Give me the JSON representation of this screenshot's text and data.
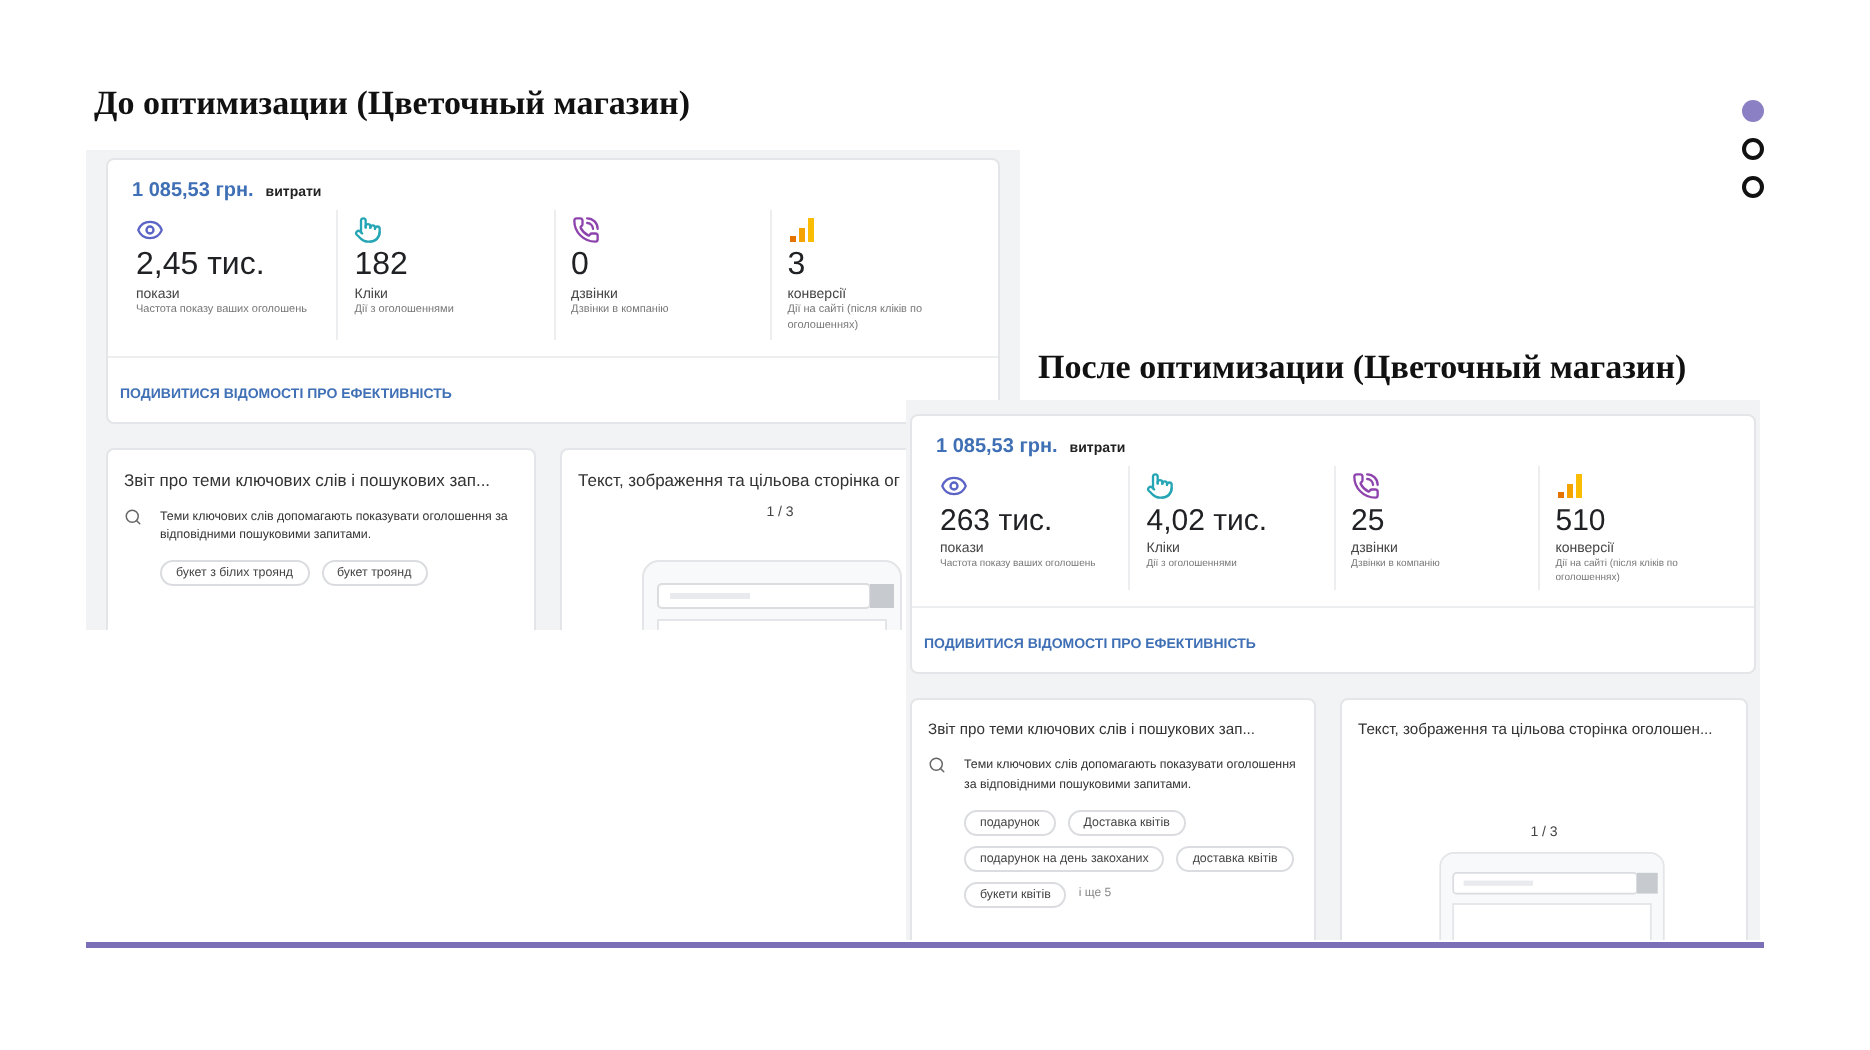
{
  "pagination": [
    {
      "selected": true
    },
    {
      "selected": false
    },
    {
      "selected": false
    }
  ],
  "panels": [
    {
      "kind": "before",
      "title": "До оптимизации (Цветочный магазин)",
      "summary": {
        "amount": "1 085,53 грн.",
        "amount_label": "витрати",
        "metrics": [
          {
            "kind": "impressions",
            "value": "2,45 тис.",
            "label": "покази",
            "description": "Частота показу ваших оголошень"
          },
          {
            "kind": "clicks",
            "value": "182",
            "label": "Кліки",
            "description": "Дії з оголошеннями"
          },
          {
            "kind": "calls",
            "value": "0",
            "label": "дзвінки",
            "description": "Дзвінки в компанію"
          },
          {
            "kind": "conversions",
            "value": "3",
            "label": "конверсії",
            "description": "Дії на сайті (після кліків по оголошеннях)"
          }
        ],
        "link": "ПОДИВИТИСЯ ВІДОМОСТІ ПРО ЕФЕКТИВНІСТЬ"
      },
      "keyword_card": {
        "title": "Звіт про теми ключових слів і пошукових зап...",
        "description": "Теми ключових слів допомагають показувати оголошення за відповідними пошуковими запитами.",
        "chips": [
          "букет з білих троянд",
          "букет троянд"
        ]
      },
      "ad_card": {
        "title": "Текст, зображення та цільова сторінка ог",
        "pager": "1 / 3"
      }
    },
    {
      "kind": "after",
      "title": "После оптимизации (Цветочный магазин)",
      "summary": {
        "amount": "1 085,53 грн.",
        "amount_label": "витрати",
        "metrics": [
          {
            "kind": "impressions",
            "value": "263 тис.",
            "label": "покази",
            "description": "Частота показу ваших оголошень"
          },
          {
            "kind": "clicks",
            "value": "4,02 тис.",
            "label": "Кліки",
            "description": "Дії з оголошеннями"
          },
          {
            "kind": "calls",
            "value": "25",
            "label": "дзвінки",
            "description": "Дзвінки в компанію"
          },
          {
            "kind": "conversions",
            "value": "510",
            "label": "конверсії",
            "description": "Дії на сайті (після кліків по оголошеннях)"
          }
        ],
        "link": "ПОДИВИТИСЯ ВІДОМОСТІ ПРО ЕФЕКТИВНІСТЬ"
      },
      "keyword_card": {
        "title": "Звіт про теми ключових слів і пошукових зап...",
        "description": "Теми ключових слів допомагають показувати оголошення за відповідними пошуковими запитами.",
        "chips": [
          "подарунок",
          "Доставка квітів",
          "подарунок на день закоханих",
          "доставка квітів",
          "букети квітів"
        ],
        "more": "і ще 5"
      },
      "ad_card": {
        "title": "Текст, зображення та цільова сторінка оголошен...",
        "pager": "1 / 3"
      }
    }
  ]
}
